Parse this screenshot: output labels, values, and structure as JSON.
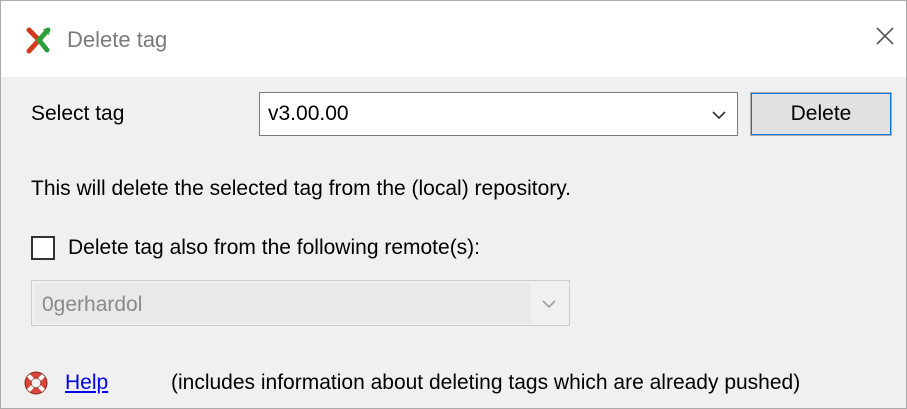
{
  "window": {
    "title": "Delete tag",
    "app_icon": "git-extensions-icon",
    "close_icon": "close-icon"
  },
  "form": {
    "select_tag_label": "Select tag",
    "selected_tag": "v3.00.00",
    "delete_button": "Delete",
    "info_text": "This will delete the selected tag from the (local) repository.",
    "remote_checkbox_label": "Delete tag also from the following remote(s):",
    "remote_checkbox_checked": false,
    "selected_remote": "0gerhardol",
    "remote_enabled": false
  },
  "footer": {
    "help_icon": "lifebuoy-icon",
    "help_link": "Help",
    "help_note": "(includes information about deleting tags which are already pushed)"
  },
  "colors": {
    "link": "#0000ee",
    "button_focus": "#0078d7",
    "dialog_bg": "#f0f0f0"
  }
}
